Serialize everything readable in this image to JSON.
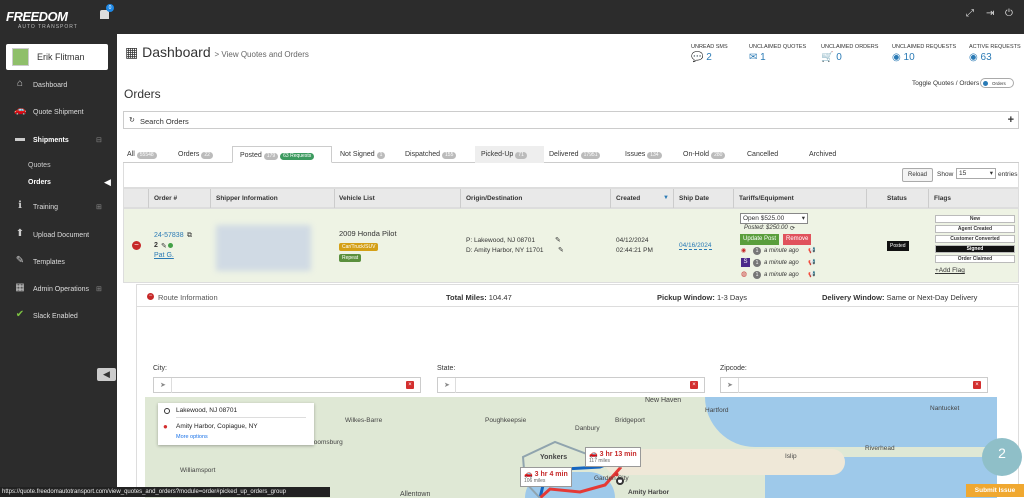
{
  "brand": {
    "name": "FREEDOM",
    "tagline": "AUTO TRANSPORT",
    "notif_count": "0"
  },
  "user": {
    "name": "Erik Flitman"
  },
  "nav": {
    "dashboard": "Dashboard",
    "quote_shipment": "Quote Shipment",
    "shipments": "Shipments",
    "quotes": "Quotes",
    "orders": "Orders",
    "training": "Training",
    "upload_document": "Upload Document",
    "templates": "Templates",
    "admin_operations": "Admin Operations",
    "slack_enabled": "Slack Enabled"
  },
  "header": {
    "title": "Dashboard",
    "subtitle": "> View Quotes and Orders"
  },
  "stats": [
    {
      "label": "UNREAD SMS",
      "value": "2"
    },
    {
      "label": "UNCLAIMED QUOTES",
      "value": "1"
    },
    {
      "label": "UNCLAIMED ORDERS",
      "value": "0"
    },
    {
      "label": "UNCLAIMED REQUESTS",
      "value": "10"
    },
    {
      "label": "ACTIVE REQUESTS",
      "value": "63"
    }
  ],
  "toggle": {
    "label": "Toggle Quotes / Orders",
    "value": "Orders"
  },
  "page_title": "Orders",
  "search": {
    "label": "Search Orders"
  },
  "tabs": [
    {
      "label": "All",
      "count": "55548"
    },
    {
      "label": "Orders",
      "count": "22"
    },
    {
      "label": "Posted",
      "count": "179",
      "extra": "63 Requests"
    },
    {
      "label": "Not Signed",
      "count": "1"
    },
    {
      "label": "Dispatched",
      "count": "155"
    },
    {
      "label": "Picked-Up",
      "count": "71"
    },
    {
      "label": "Delivered",
      "count": "17951"
    },
    {
      "label": "Issues",
      "count": "134"
    },
    {
      "label": "On-Hold",
      "count": "280"
    },
    {
      "label": "Cancelled",
      "count": ""
    },
    {
      "label": "Archived",
      "count": ""
    }
  ],
  "toolbar": {
    "reload": "Reload",
    "show": "Show",
    "show_value": "15",
    "entries": "entries"
  },
  "columns": [
    "Order #",
    "Shipper Information",
    "Vehicle List",
    "Origin/Destination",
    "Created",
    "Ship Date",
    "Tariffs/Equipment",
    "Status",
    "Flags"
  ],
  "order": {
    "number": "24-57838",
    "count": "2",
    "agent": "Pat G.",
    "vehicle": "2009 Honda Pilot",
    "vehicle_tag": "Car/Truck/SUV",
    "vehicle_tag2": "Repeat",
    "pickup": "P: Lakewood, NJ 08701",
    "dropoff": "D: Amity Harbor, NY 11701",
    "created_date": "04/12/2024",
    "created_time": "02:44:21 PM",
    "ship_date": "04/16/2024",
    "tariff_select": "Open $525.00",
    "posted": "Posted: $250.00",
    "update_btn": "Update Post",
    "remove_btn": "Remove",
    "ago1": "a minute ago",
    "ago2": "a minute ago",
    "ago3": "a minute ago",
    "ago_count": "1",
    "status": "Posted",
    "flags": [
      "New",
      "Agent Created",
      "Customer Converted",
      "Signed",
      "Order Claimed"
    ],
    "add_flag": "Add Flag"
  },
  "route": {
    "title": "Route Information",
    "total_miles_label": "Total Miles:",
    "total_miles": "104.47",
    "pickup_label": "Pickup Window:",
    "pickup": "1-3 Days",
    "delivery_label": "Delivery Window:",
    "delivery": "Same or Next-Day Delivery",
    "city": "City:",
    "state": "State:",
    "zipcode": "Zipcode:"
  },
  "map": {
    "from": "Lakewood, NJ 08701",
    "to": "Amity Harbor, Copiague, NY",
    "more": "More options",
    "time1": "3 hr 13 min",
    "miles1": "117 miles",
    "time2": "3 hr 4 min",
    "miles2": "106 miles",
    "labels": [
      "Hartford",
      "Wilkes-Barre",
      "Bloomsburg",
      "Allentown",
      "Yonkers",
      "New Haven",
      "Islip",
      "Garden City",
      "Amity Harbor",
      "Williamsport",
      "Poughkeepsie",
      "Danbury",
      "Bridgeport",
      "Riverhead",
      "Nantucket"
    ]
  },
  "statusbar": {
    "url": "https://quote.freedomautotransport.com/view_quotes_and_orders?module=order#picked_up_orders_group"
  },
  "chat_count": "2",
  "submit_issue": "Submit Issue"
}
